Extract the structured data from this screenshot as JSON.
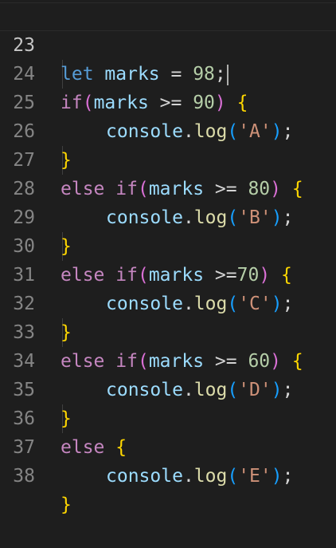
{
  "editor": {
    "lines": [
      {
        "number": "23",
        "tokens": [
          "let",
          " ",
          "marks",
          " = ",
          "98",
          ";"
        ]
      },
      {
        "number": "24",
        "tokens": [
          "if",
          "(",
          "marks",
          " >= ",
          "90",
          ")",
          " ",
          "{"
        ]
      },
      {
        "number": "25",
        "tokens": [
          "console",
          ".",
          "log",
          "(",
          "'A'",
          ")",
          ";"
        ]
      },
      {
        "number": "26",
        "tokens": [
          "}"
        ]
      },
      {
        "number": "27",
        "tokens": [
          "else",
          " ",
          "if",
          "(",
          "marks",
          " >= ",
          "80",
          ")",
          " ",
          "{"
        ]
      },
      {
        "number": "28",
        "tokens": [
          "console",
          ".",
          "log",
          "(",
          "'B'",
          ")",
          ";"
        ]
      },
      {
        "number": "29",
        "tokens": [
          "}"
        ]
      },
      {
        "number": "30",
        "tokens": [
          "else",
          " ",
          "if",
          "(",
          "marks",
          " >=",
          "70",
          ")",
          " ",
          "{"
        ]
      },
      {
        "number": "31",
        "tokens": [
          "console",
          ".",
          "log",
          "(",
          "'C'",
          ")",
          ";"
        ]
      },
      {
        "number": "32",
        "tokens": [
          "}"
        ]
      },
      {
        "number": "33",
        "tokens": [
          "else",
          " ",
          "if",
          "(",
          "marks",
          " >= ",
          "60",
          ")",
          " ",
          "{"
        ]
      },
      {
        "number": "34",
        "tokens": [
          "console",
          ".",
          "log",
          "(",
          "'D'",
          ")",
          ";"
        ]
      },
      {
        "number": "35",
        "tokens": [
          "}"
        ]
      },
      {
        "number": "36",
        "tokens": [
          "else",
          " ",
          "{"
        ]
      },
      {
        "number": "37",
        "tokens": [
          "console",
          ".",
          "log",
          "(",
          "'E'",
          ")",
          ";"
        ]
      },
      {
        "number": "38",
        "tokens": [
          "}"
        ]
      }
    ]
  }
}
